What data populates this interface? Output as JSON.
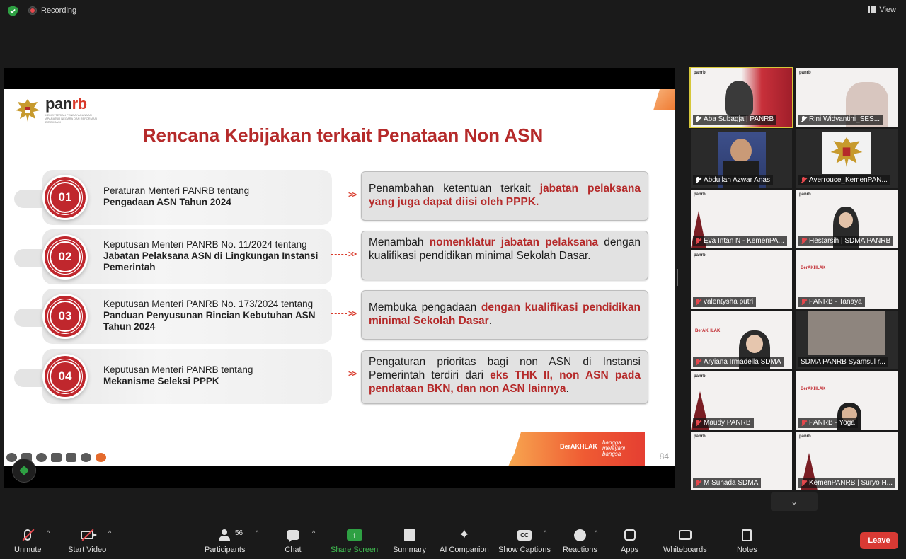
{
  "topbar": {
    "recording_label": "Recording",
    "view_label": "View"
  },
  "slide": {
    "logo_text_main": "pan",
    "logo_text_accent": "rb",
    "logo_subtitle": "KEMENTERIAN PENDAYAGUNAAN APARATUR NEGARA DAN REFORMASI BIROKRASI",
    "title": "Rencana Kebijakan terkait Penataan Non ASN",
    "rows": [
      {
        "number": "01",
        "left_plain": "Peraturan Menteri PANRB tentang",
        "left_bold": "Pengadaan ASN Tahun 2024",
        "right_plain_before": "Penambahan ketentuan terkait ",
        "right_highlight": "jabatan pelaksana yang juga dapat diisi oleh PPPK.",
        "right_plain_after": ""
      },
      {
        "number": "02",
        "left_plain": "Keputusan Menteri PANRB No. 11/2024 tentang ",
        "left_bold": "Jabatan Pelaksana ASN di Lingkungan Instansi Pemerintah",
        "right_plain_before": "Menambah ",
        "right_highlight": "nomenklatur jabatan pelaksana",
        "right_plain_after": " dengan kualifikasi pendidikan minimal Sekolah Dasar."
      },
      {
        "number": "03",
        "left_plain": "Keputusan Menteri PANRB No. 173/2024 tentang ",
        "left_bold": "Panduan Penyusunan Rincian Kebutuhan ASN Tahun 2024",
        "right_plain_before": "Membuka pengadaan ",
        "right_highlight": "dengan kualifikasi pendidikan minimal Sekolah Dasar",
        "right_plain_after": "."
      },
      {
        "number": "04",
        "left_plain": "Keputusan Menteri PANRB tentang",
        "left_bold": "Mekanisme Seleksi PPPK",
        "right_plain_before": "Pengaturan prioritas bagi non ASN di Instansi Pemerintah terdiri dari ",
        "right_highlight": "eks THK II, non ASN pada pendataan BKN, dan non ASN lainnya",
        "right_plain_after": "."
      }
    ],
    "footer_brand": "BerAKHLAK",
    "footer_tagline": "bangga melayani bangsa",
    "page_number": "84"
  },
  "participants": [
    {
      "name": "Aba Subagja | PANRB",
      "muted": false,
      "active": true
    },
    {
      "name": "Rini Widyantini_SES...",
      "muted": false,
      "active": false
    },
    {
      "name": "Abdullah Azwar Anas",
      "muted": false,
      "active": false
    },
    {
      "name": "Averrouce_KemenPAN...",
      "muted": true,
      "active": false
    },
    {
      "name": "Eva Intan N - KemenPA...",
      "muted": true,
      "active": false
    },
    {
      "name": "Hestarsih | SDMA PANRB",
      "muted": true,
      "active": false
    },
    {
      "name": "valentysha putri",
      "muted": true,
      "active": false
    },
    {
      "name": "PANRB - Tanaya",
      "muted": true,
      "active": false
    },
    {
      "name": "Aryiana Irmadella SDMA",
      "muted": true,
      "active": false
    },
    {
      "name": "SDMA PANRB Syamsul r...",
      "muted": false,
      "active": false
    },
    {
      "name": "Maudy PANRB",
      "muted": true,
      "active": false
    },
    {
      "name": "PANRB - Yoga",
      "muted": true,
      "active": false
    },
    {
      "name": "M Suhada SDMA",
      "muted": true,
      "active": false
    },
    {
      "name": "KemenPANRB | Suryo H...",
      "muted": true,
      "active": false
    }
  ],
  "toolbar": {
    "unmute": "Unmute",
    "start_video": "Start Video",
    "participants": "Participants",
    "participants_count": "56",
    "chat": "Chat",
    "share_screen": "Share Screen",
    "summary": "Summary",
    "ai_companion": "AI Companion",
    "show_captions": "Show Captions",
    "cc_glyph": "CC",
    "reactions": "Reactions",
    "apps": "Apps",
    "whiteboards": "Whiteboards",
    "notes": "Notes",
    "leave": "Leave"
  },
  "colors": {
    "accent_red": "#b52a2a",
    "share_green": "#2ea043",
    "leave_red": "#d93a34",
    "active_speaker": "#d6c73a"
  }
}
